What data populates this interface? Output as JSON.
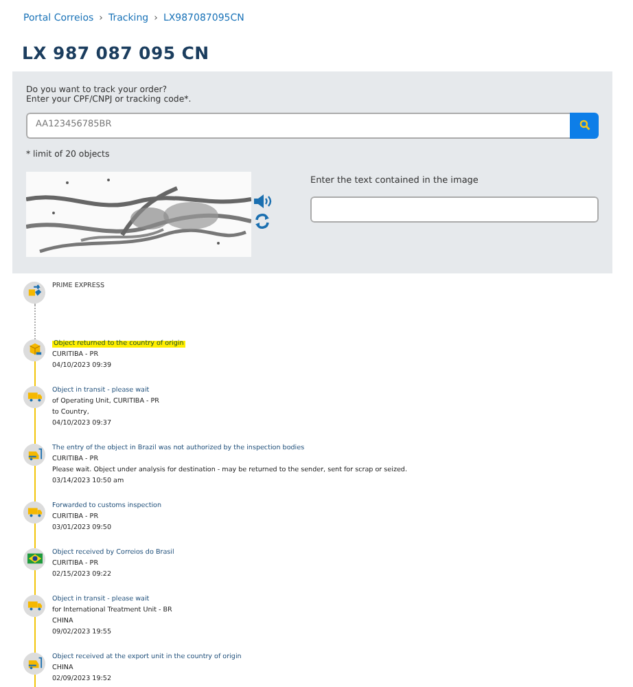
{
  "breadcrumb": [
    "Portal Correios",
    "Tracking",
    "LX987087095CN"
  ],
  "breadcrumb_separator": "›",
  "title": "LX 987 087 095 CN",
  "search": {
    "prompt_lines": [
      "Do you want to track your order?",
      "Enter your CPF/CNPJ or tracking code*."
    ],
    "placeholder": "AA123456785BR",
    "note": "* limit of 20 objects"
  },
  "captcha": {
    "kind": "picture",
    "label": "Enter the text contained in the image"
  },
  "events": [
    {
      "kind": "carrier",
      "title": "PRIME EXPRESS",
      "highlighted": false
    },
    {
      "kind": "box",
      "title": "Object returned to the country of origin",
      "lines": [
        "CURITIBA - PR"
      ],
      "date": "04/10/2023 09:39",
      "highlighted": true
    },
    {
      "kind": "truck",
      "title": "Object in transit - please wait",
      "lines": [
        "of Operating Unit, CURITIBA - PR",
        "to Country,"
      ],
      "date": "04/10/2023 09:37",
      "highlighted": false
    },
    {
      "kind": "forklift",
      "title": "The entry of the object in Brazil was not authorized by the inspection bodies",
      "lines": [
        "CURITIBA - PR",
        "Please wait. Object under analysis for destination - may be returned to the sender, sent for scrap or seized."
      ],
      "date": "03/14/2023 10:50 am",
      "highlighted": false
    },
    {
      "kind": "truck",
      "title": "Forwarded to customs inspection",
      "lines": [
        "CURITIBA - PR"
      ],
      "date": "03/01/2023 09:50",
      "highlighted": false
    },
    {
      "kind": "flag",
      "title": "Object received by Correios do Brasil",
      "lines": [
        "CURITIBA - PR"
      ],
      "date": "02/15/2023 09:22",
      "highlighted": false
    },
    {
      "kind": "truck",
      "title": "Object in transit - please wait",
      "lines": [
        "for International Treatment Unit - BR",
        "CHINA"
      ],
      "date": "09/02/2023 19:55",
      "highlighted": false
    },
    {
      "kind": "forklift",
      "title": "Object received at the export unit in the country of origin",
      "lines": [
        "CHINA"
      ],
      "date": "02/09/2023 19:52",
      "highlighted": false
    }
  ]
}
